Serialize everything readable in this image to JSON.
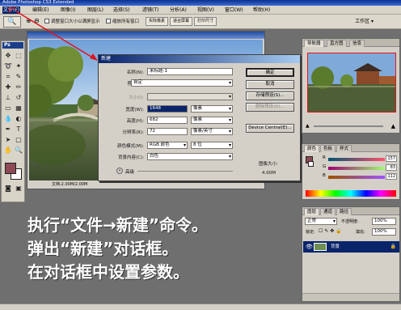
{
  "app": {
    "title": "Adobe Photoshop CS3 Extended"
  },
  "menu": [
    "文件(F)",
    "编辑(E)",
    "图像(I)",
    "图层(L)",
    "选择(S)",
    "滤镜(T)",
    "分析(A)",
    "视图(V)",
    "窗口(W)",
    "帮助(H)"
  ],
  "options_bar": {
    "resize_windows_label": "调整窗口大小以满屏显示",
    "all_windows_label": "缩放所有窗口",
    "actual_pixels_btn": "实际像素",
    "fit_screen_btn": "适合屏幕",
    "print_size_btn": "打印尺寸",
    "workspace_label": "工作区 ▾"
  },
  "tools": {
    "panel_label": "Ps"
  },
  "document": {
    "title": "",
    "status_text": "文档:2.00M/2.00M"
  },
  "new_dialog": {
    "title": "新建",
    "name_label": "名称(N):",
    "name_value": "未标题-1",
    "preset_label": "预设(P):",
    "preset_value": "自定",
    "size_label": "大小(I):",
    "width_label": "宽度(W):",
    "width_value": "1648",
    "width_unit": "像素",
    "height_label": "高度(H):",
    "height_value": "682",
    "height_unit": "像素",
    "resolution_label": "分辨率(R):",
    "resolution_value": "72",
    "resolution_unit": "像素/英寸",
    "color_mode_label": "颜色模式(M):",
    "color_mode_value": "RGB 颜色",
    "bit_depth_value": "8 位",
    "bg_contents_label": "背景内容(C):",
    "bg_contents_value": "白色",
    "advanced_label": "高级",
    "ok_button": "确定",
    "cancel_button": "取消",
    "save_preset_button": "存储预设(S)...",
    "delete_preset_button": "删除预设(D)...",
    "device_central_button": "Device Central(E)...",
    "image_size_label": "图像大小:",
    "image_size_value": "4.00M"
  },
  "navigator": {
    "tabs": [
      "导航器",
      "直方图",
      "信息"
    ]
  },
  "color_panel": {
    "tabs": [
      "颜色",
      "色板",
      "样式"
    ],
    "r_label": "R",
    "g_label": "G",
    "b_label": "B",
    "r_value": "157",
    "g_value": "83",
    "b_value": "112"
  },
  "layers_panel": {
    "tabs": [
      "图层",
      "通道",
      "路径"
    ],
    "blend_mode": "正常",
    "opacity_label": "不透明度:",
    "opacity_value": "100%",
    "lock_label": "锁定:",
    "fill_label": "填充:",
    "fill_value": "100%",
    "layer_name": "背景"
  },
  "caption": {
    "line1": "执行“文件→新建”命令。",
    "line2": "弹出“新建”对话框。",
    "line3": "在对话框中设置参数。"
  },
  "colors": {
    "accent_red": "#e0141e",
    "titlebar_blue": "#0a246a",
    "foreground_swatch": "#8d4a55"
  }
}
